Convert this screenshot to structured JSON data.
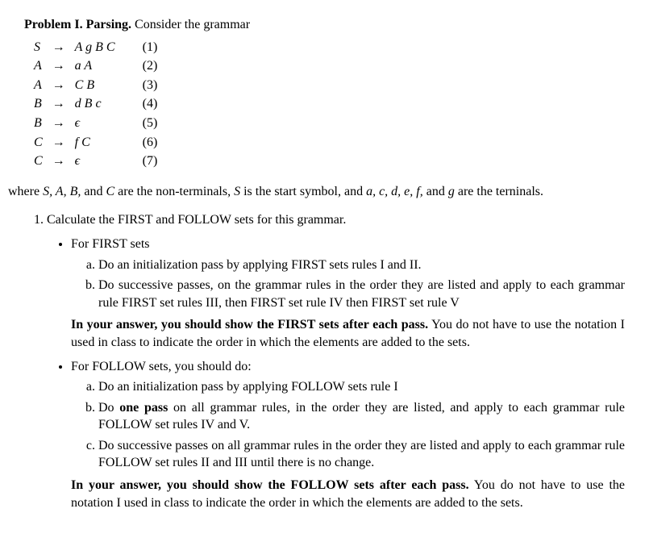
{
  "title": {
    "label": "Problem I. Parsing.",
    "tail": " Consider the grammar"
  },
  "grammar": [
    {
      "lhs": "S",
      "rhs": "A g B C",
      "num": "(1)"
    },
    {
      "lhs": "A",
      "rhs": "a A",
      "num": "(2)"
    },
    {
      "lhs": "A",
      "rhs": "C B",
      "num": "(3)"
    },
    {
      "lhs": "B",
      "rhs": "d B c",
      "num": "(4)"
    },
    {
      "lhs": "B",
      "rhs": "ϵ",
      "num": "(5)"
    },
    {
      "lhs": "C",
      "rhs": "f C",
      "num": "(6)"
    },
    {
      "lhs": "C",
      "rhs": "ϵ",
      "num": "(7)"
    }
  ],
  "arrow": "→",
  "where_line": {
    "pre": "where ",
    "nts": "S, A, B, ",
    "and1": "and ",
    "c": "C",
    "mid": " are the non-terminals, ",
    "s": "S",
    "mid2": " is the start symbol, and ",
    "ts": "a, c, d, e, f, ",
    "and2": "and ",
    "g": "g",
    "tail": " are the terninals."
  },
  "task1": "Calculate the FIRST and FOLLOW sets for this grammar.",
  "first": {
    "head": "For FIRST sets",
    "a": "Do an initialization pass by applying FIRST sets rules I and II.",
    "b": "Do successive passes, on the grammar rules in the order they are listed and apply to each grammar rule FIRST set rules III, then FIRST set rule IV then FIRST set rule V",
    "note_bold": "In your answer, you should show the FIRST sets after each pass.",
    "note_tail": " You do not have to use the notation I used in class to indicate the order in which the elements are added to the sets."
  },
  "follow": {
    "head": "For FOLLOW sets, you should do:",
    "a": "Do an initialization pass by applying FOLLOW sets rule I",
    "b_pre": "Do ",
    "b_bold": "one pass",
    "b_post": " on all grammar rules, in the order they are listed, and apply to each grammar rule FOLLOW set rules IV and V.",
    "c": "Do successive passes on all grammar rules in the order they are listed and apply to each grammar rule FOLLOW set rules II and III until there is no change.",
    "note_bold": "In your answer, you should show the FOLLOW sets after each pass.",
    "note_tail": " You do not have to use the notation I used in class to indicate the order in which the elements are added to the sets."
  }
}
